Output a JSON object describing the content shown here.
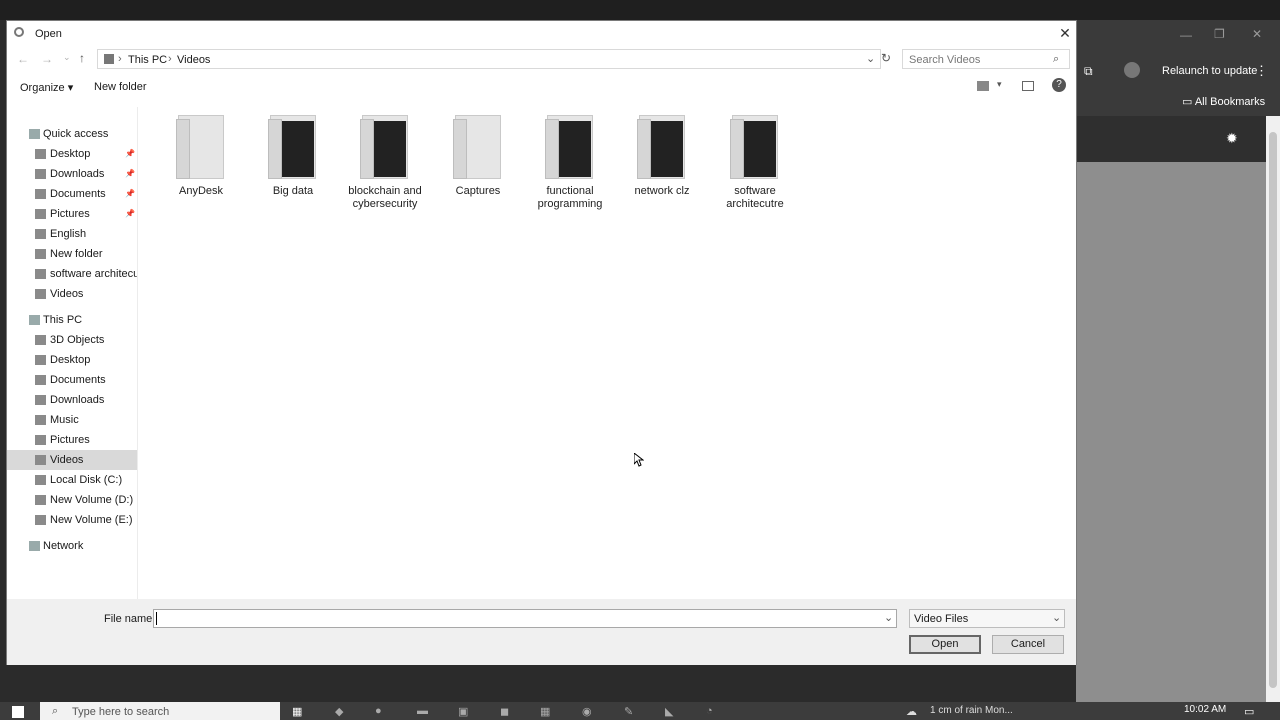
{
  "dialog": {
    "title": "Open",
    "close_glyph": "✕",
    "breadcrumb": [
      "This PC",
      "Videos"
    ],
    "search_placeholder": "Search Videos",
    "toolbar": {
      "organize": "Organize ▾",
      "new_folder": "New folder",
      "help": "?"
    },
    "sidebar": [
      {
        "label": "Quick access",
        "icon": "star-icon",
        "indent": 0,
        "section": true
      },
      {
        "label": "Desktop",
        "icon": "desktop-icon",
        "indent": 1,
        "pinned": true
      },
      {
        "label": "Downloads",
        "icon": "download-icon",
        "indent": 1,
        "pinned": true
      },
      {
        "label": "Documents",
        "icon": "document-icon",
        "indent": 1,
        "pinned": true
      },
      {
        "label": "Pictures",
        "icon": "pictures-icon",
        "indent": 1,
        "pinned": true
      },
      {
        "label": "English",
        "icon": "folder-icon",
        "indent": 1
      },
      {
        "label": "New folder",
        "icon": "folder-icon",
        "indent": 1
      },
      {
        "label": "software architecutr",
        "icon": "folder-icon",
        "indent": 1
      },
      {
        "label": "Videos",
        "icon": "videos-icon",
        "indent": 1
      },
      {
        "label": "This PC",
        "icon": "computer-icon",
        "indent": 0,
        "section": true
      },
      {
        "label": "3D Objects",
        "icon": "3d-objects-icon",
        "indent": 1
      },
      {
        "label": "Desktop",
        "icon": "desktop-icon",
        "indent": 1
      },
      {
        "label": "Documents",
        "icon": "document-icon",
        "indent": 1
      },
      {
        "label": "Downloads",
        "icon": "download-icon",
        "indent": 1
      },
      {
        "label": "Music",
        "icon": "music-icon",
        "indent": 1
      },
      {
        "label": "Pictures",
        "icon": "pictures-icon",
        "indent": 1
      },
      {
        "label": "Videos",
        "icon": "videos-icon",
        "indent": 1,
        "selected": true
      },
      {
        "label": "Local Disk (C:)",
        "icon": "drive-icon",
        "indent": 1
      },
      {
        "label": "New Volume (D:)",
        "icon": "drive-icon",
        "indent": 1
      },
      {
        "label": "New Volume (E:)",
        "icon": "drive-icon",
        "indent": 1
      },
      {
        "label": "Network",
        "icon": "network-icon",
        "indent": 0,
        "section": true
      }
    ],
    "folders": [
      {
        "name": "AnyDesk",
        "thumbnail": false
      },
      {
        "name": "Big data",
        "thumbnail": true
      },
      {
        "name": "blockchain and cybersecurity",
        "thumbnail": true
      },
      {
        "name": "Captures",
        "thumbnail": false
      },
      {
        "name": "functional programming",
        "thumbnail": true
      },
      {
        "name": "network clz",
        "thumbnail": true
      },
      {
        "name": "software architecutre",
        "thumbnail": true
      }
    ],
    "file_name_label": "File name:",
    "file_name_value": "",
    "file_type": "Video Files",
    "open_label": "Open",
    "cancel_label": "Cancel"
  },
  "browser": {
    "relaunch_label": "Relaunch to update",
    "bookmarks_label": "All Bookmarks"
  },
  "taskbar": {
    "search_placeholder": "Type here to search",
    "clock_time": "10:02 AM",
    "weather_text": "1 cm of rain Mon..."
  }
}
